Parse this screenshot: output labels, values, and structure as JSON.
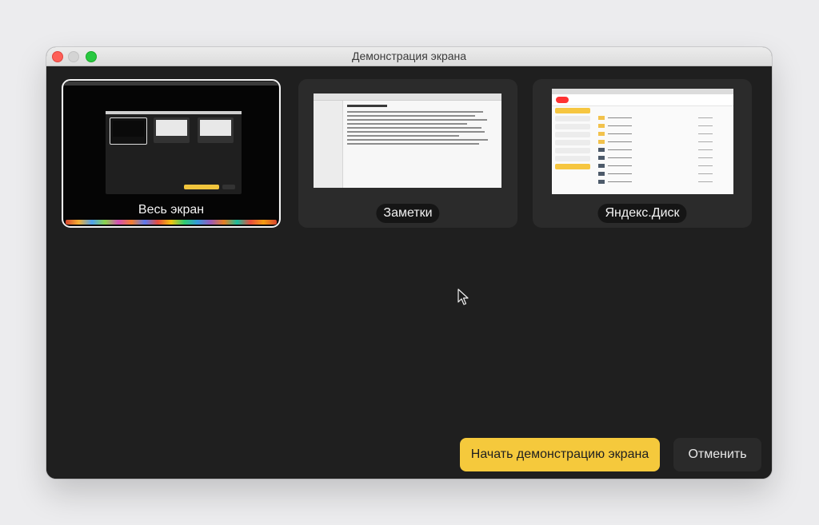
{
  "window": {
    "title": "Демонстрация экрана"
  },
  "sources": [
    {
      "label": "Весь экран",
      "selected": true
    },
    {
      "label": "Заметки",
      "selected": false
    },
    {
      "label": "Яндекс.Диск",
      "selected": false
    }
  ],
  "buttons": {
    "start": "Начать демонстрацию экрана",
    "cancel": "Отменить"
  },
  "icons": {
    "close": "close-icon",
    "minimize": "minimize-icon",
    "zoom": "zoom-icon",
    "cursor": "mouse-pointer-icon"
  },
  "colors": {
    "accent": "#f5c93c",
    "window_bg": "#1f1f1f",
    "card_bg": "#2b2b2b"
  }
}
